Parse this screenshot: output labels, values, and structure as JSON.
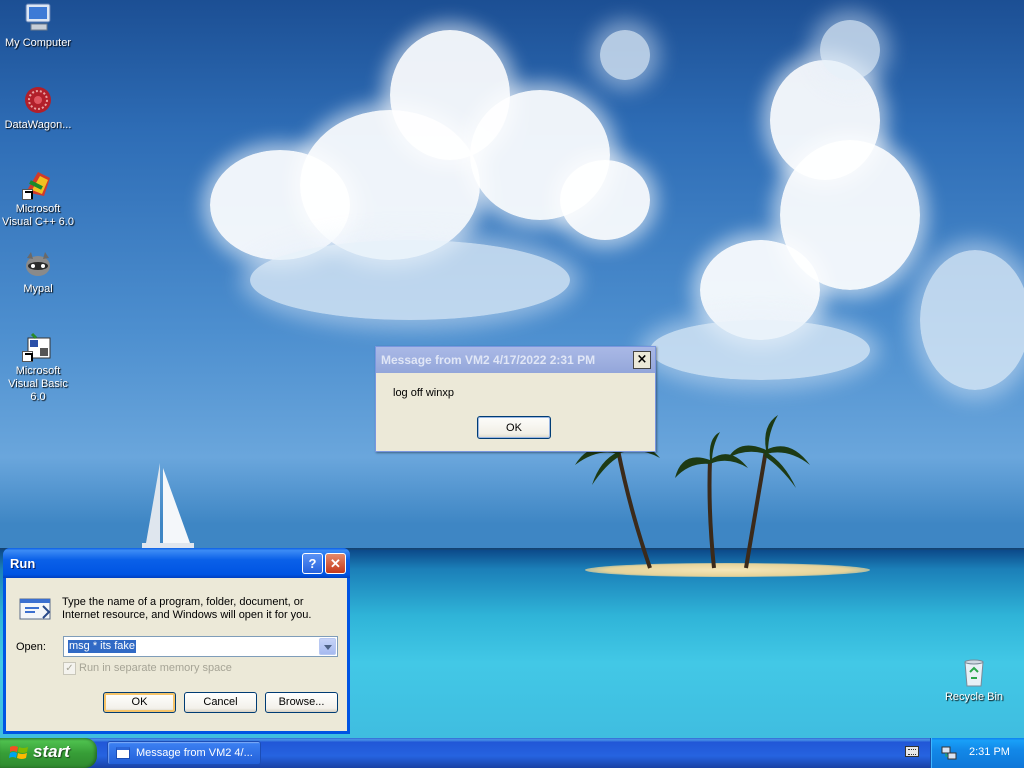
{
  "desktop": {
    "icons": [
      {
        "label": "My Computer",
        "icon": "my-computer-icon"
      },
      {
        "label": "DataWagon...",
        "icon": "datawagon-icon"
      },
      {
        "label": "Microsoft Visual C++ 6.0",
        "icon": "visual-cpp-icon"
      },
      {
        "label": "Mypal",
        "icon": "mypal-icon"
      },
      {
        "label": "Microsoft Visual Basic 6.0",
        "icon": "visual-basic-icon"
      },
      {
        "label": "Recycle Bin",
        "icon": "recycle-bin-icon"
      }
    ]
  },
  "message_dialog": {
    "title": "Message from VM2 4/17/2022 2:31 PM",
    "close_label": "×",
    "text": "log off winxp",
    "ok_label": "OK"
  },
  "run_dialog": {
    "title": "Run",
    "help_label": "?",
    "close_label": "✕",
    "description": "Type the name of a program, folder, document, or Internet resource, and Windows will open it for you.",
    "open_label": "Open:",
    "open_value": "msg * its fake",
    "checkbox_label": "Run in separate memory space",
    "checkbox_checked": true,
    "ok_label": "OK",
    "cancel_label": "Cancel",
    "browse_label": "Browse..."
  },
  "taskbar": {
    "start_label": "start",
    "task_button_label": "Message from VM2 4/...",
    "clock": "2:31 PM"
  },
  "colors": {
    "titlebar_active": "#0054e3",
    "taskbar": "#245edb",
    "start_button": "#3c9a3c",
    "dialog_face": "#ece9d8"
  }
}
